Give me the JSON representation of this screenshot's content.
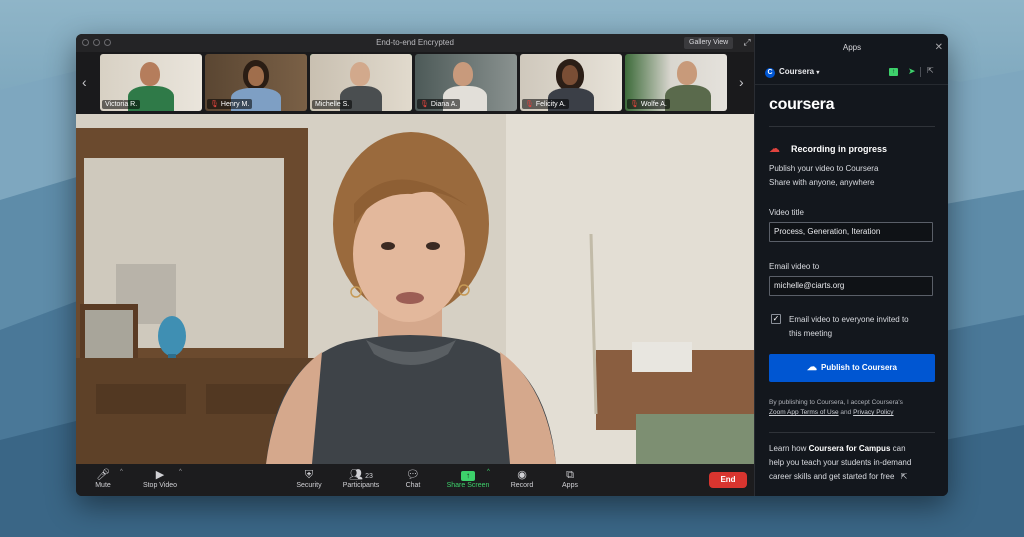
{
  "window": {
    "title": "End-to-end Encrypted",
    "gallery_view_label": "Gallery View"
  },
  "participants_strip": [
    {
      "name": "Victoria R.",
      "muted": false
    },
    {
      "name": "Henry M.",
      "muted": true
    },
    {
      "name": "Michelle S.",
      "muted": false,
      "active": true
    },
    {
      "name": "Diana A.",
      "muted": true
    },
    {
      "name": "Felicity A.",
      "muted": true
    },
    {
      "name": "Wolfe A.",
      "muted": true
    }
  ],
  "toolbar": {
    "mute": "Mute",
    "stop_video": "Stop Video",
    "security": "Security",
    "participants": "Participants",
    "participants_count": "23",
    "chat": "Chat",
    "share_screen": "Share Screen",
    "record": "Record",
    "apps": "Apps",
    "end": "End"
  },
  "panel": {
    "title": "Apps",
    "app_name": "Coursera",
    "logo_text": "coursera",
    "recording_title": "Recording in progress",
    "recording_line1": "Publish your video to Coursera",
    "recording_line2": "Share with anyone, anywhere",
    "video_title_label": "Video title",
    "video_title_value": "Process, Generation, Iteration",
    "email_label": "Email video to",
    "email_value": "michelle@ciarts.org",
    "checkbox_label_line1": "Email video to everyone invited to",
    "checkbox_label_line2": "this meeting",
    "publish_button": "Publish to Coursera",
    "terms_line1": "By publishing to Coursera, I accept Coursera's",
    "terms_link1": "Zoom App Terms of Use",
    "terms_and": " and ",
    "terms_link2": "Privacy Policy",
    "promo_prefix": "Learn how ",
    "promo_bold": "Coursera for Campus",
    "promo_suffix1": " can",
    "promo_line2": "help you teach your students in-demand",
    "promo_line3": "career skills and get started for free"
  },
  "colors": {
    "accent_green": "#3dd16b",
    "end_red": "#d8352f",
    "coursera_blue": "#0056d2"
  }
}
